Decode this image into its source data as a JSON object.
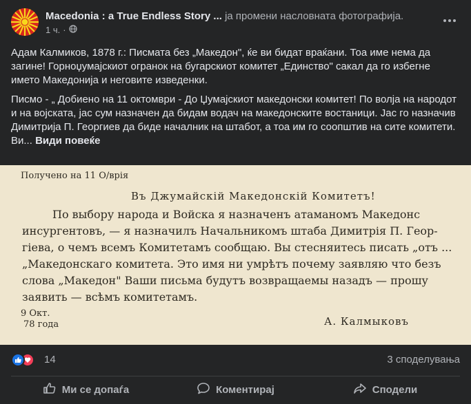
{
  "post": {
    "page_name": "Macedonia : a True Endless Story ...",
    "action": "ја промени насловната фотографија.",
    "time": "1 ч.",
    "paragraph1": "Адам Калмиков, 1878 г.: Писмата без „Македон\", ќе ви бидат враќани. Тоа име нема да загине! Горноџумајскиот огранок на бугарскиот комитет „Единство\" сакал да го избегне името Македонија и неговите изведенки.",
    "paragraph2": "Писмо - „ Добиено на 11 октомври - До Џумајскиот македонски комитет! По волја на народот и на војската, јас сум назначен да бидам водач на македонските востаници. Јас го назначив Димитрија П. Георгиев да биде началник на штабот, а тоа им го соопштив на сите комитети. Ви...",
    "see_more": "Види повеќе"
  },
  "photo": {
    "lines": [
      "Получено на 11 О/врія",
      "Въ Джумайскій Македонскій Комитетъ!",
      "По выбору народа и Войска я назначенъ атаманомъ Македонс",
      "инсургентовъ, — я назначилъ Начальникомъ штаба Димитрія П. Геор-",
      "гіева, о чемъ всемъ Комитетамъ сообщаю. Вы стесняитесь писать „отъ ...",
      "„Македонскаго комитета. Это имя ни умрѣтъ почему заявляю что безъ",
      "слова „Македон\" Ваши письма будутъ возвращаемы назадъ — прошу",
      "заявить — всѣмъ комитетамъ.",
      "9 Окт.",
      "78 года",
      "А. Калмыковъ"
    ]
  },
  "stats": {
    "reaction_count": "14",
    "shares": "3 споделувања"
  },
  "actions": {
    "like": "Ми се допаѓа",
    "comment": "Коментирај",
    "share": "Сподели"
  }
}
